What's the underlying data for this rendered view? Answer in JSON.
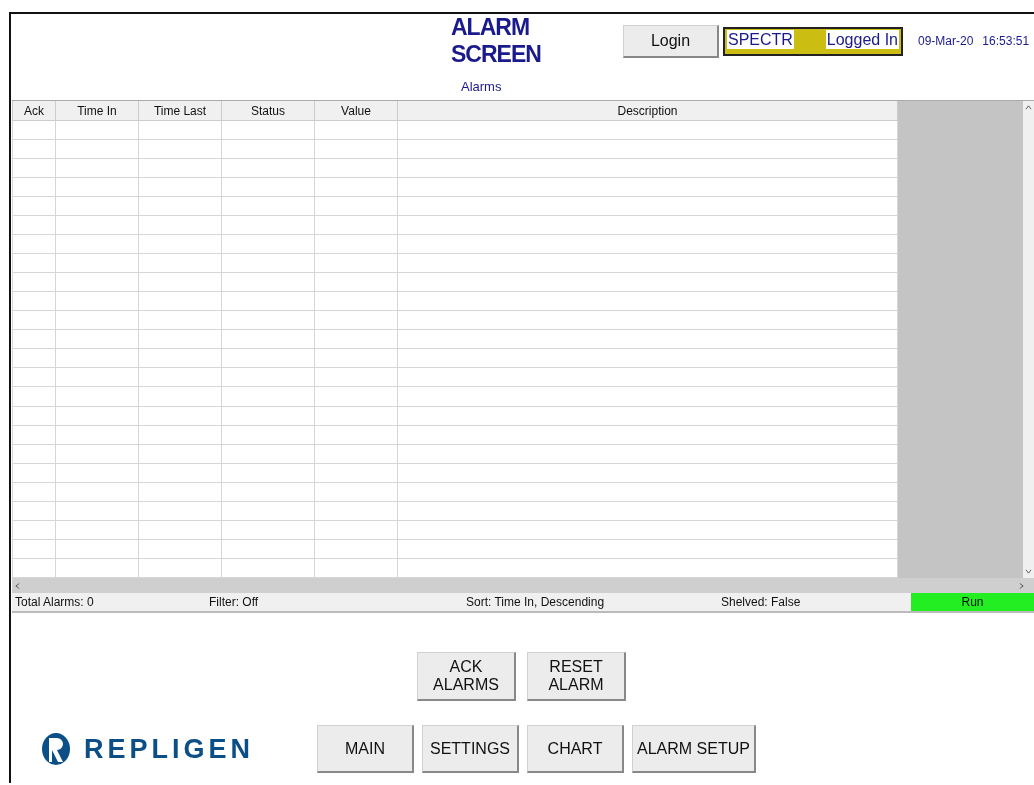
{
  "header": {
    "title": "ALARM SCREEN",
    "login_button": "Login",
    "user": "SPECTR",
    "login_status": "Logged In",
    "date": "09-Mar-20",
    "time": "16:53:51"
  },
  "panel_title": "Alarms",
  "table": {
    "columns": [
      "Ack",
      "Time In",
      "Time Last",
      "Status",
      "Value",
      "Description"
    ]
  },
  "status_bar": {
    "total": "Total Alarms: 0",
    "filter": "Filter: Off",
    "sort": "Sort: Time In, Descending",
    "shelved": "Shelved: False",
    "state": "Run"
  },
  "action_buttons": [
    "ACK\nALARMS",
    "RESET\nALARM"
  ],
  "logo": {
    "text": "REPLIGEN"
  },
  "nav_buttons": [
    "MAIN",
    "SETTINGS",
    "CHART",
    "ALARM SETUP"
  ]
}
